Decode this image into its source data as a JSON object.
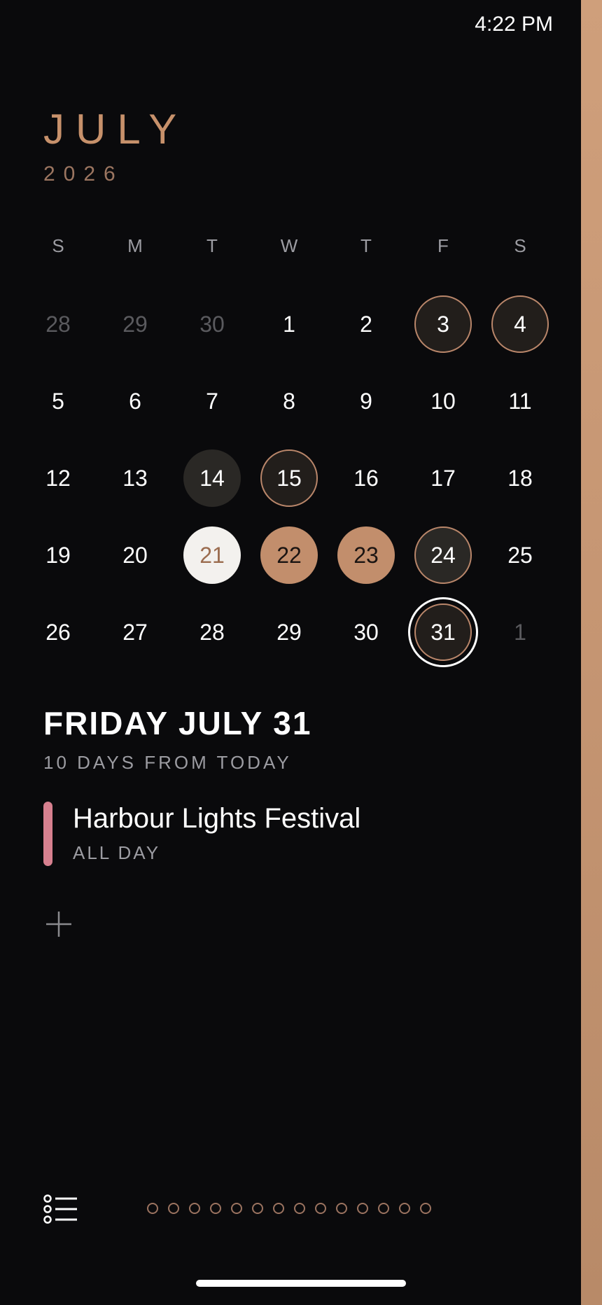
{
  "status_bar": {
    "time": "4:22 PM"
  },
  "header": {
    "month": "JULY",
    "year": "2026"
  },
  "weekdays": [
    "S",
    "M",
    "T",
    "W",
    "T",
    "F",
    "S"
  ],
  "calendar": {
    "rows": [
      [
        {
          "label": "28",
          "style": "muted"
        },
        {
          "label": "29",
          "style": "muted"
        },
        {
          "label": "30",
          "style": "muted"
        },
        {
          "label": "1",
          "style": "plain"
        },
        {
          "label": "2",
          "style": "plain"
        },
        {
          "label": "3",
          "style": "outlined"
        },
        {
          "label": "4",
          "style": "outlined"
        }
      ],
      [
        {
          "label": "5",
          "style": "plain"
        },
        {
          "label": "6",
          "style": "plain"
        },
        {
          "label": "7",
          "style": "plain"
        },
        {
          "label": "8",
          "style": "plain"
        },
        {
          "label": "9",
          "style": "plain"
        },
        {
          "label": "10",
          "style": "plain"
        },
        {
          "label": "11",
          "style": "plain"
        }
      ],
      [
        {
          "label": "12",
          "style": "plain"
        },
        {
          "label": "13",
          "style": "plain"
        },
        {
          "label": "14",
          "style": "dark"
        },
        {
          "label": "15",
          "style": "outlined"
        },
        {
          "label": "16",
          "style": "plain"
        },
        {
          "label": "17",
          "style": "plain"
        },
        {
          "label": "18",
          "style": "plain"
        }
      ],
      [
        {
          "label": "19",
          "style": "plain"
        },
        {
          "label": "20",
          "style": "plain"
        },
        {
          "label": "21",
          "style": "today"
        },
        {
          "label": "22",
          "style": "copper"
        },
        {
          "label": "23",
          "style": "copper"
        },
        {
          "label": "24",
          "style": "dark-outlined"
        },
        {
          "label": "25",
          "style": "plain"
        }
      ],
      [
        {
          "label": "26",
          "style": "plain"
        },
        {
          "label": "27",
          "style": "plain"
        },
        {
          "label": "28",
          "style": "plain"
        },
        {
          "label": "29",
          "style": "plain"
        },
        {
          "label": "30",
          "style": "plain"
        },
        {
          "label": "31",
          "style": "selected"
        },
        {
          "label": "1",
          "style": "muted"
        }
      ]
    ]
  },
  "selected_day": {
    "heading": "FRIDAY JULY 31",
    "subheading": "10 DAYS FROM TODAY"
  },
  "events": [
    {
      "title": "Harbour Lights Festival",
      "time": "ALL DAY",
      "color": "#d7808f"
    }
  ],
  "colors": {
    "accent": "#c7916b",
    "copper": "#c28e6c",
    "background": "#0a0a0c"
  },
  "icons": {
    "add": "plus-icon",
    "list": "list-icon"
  },
  "pager": {
    "count": 14
  }
}
